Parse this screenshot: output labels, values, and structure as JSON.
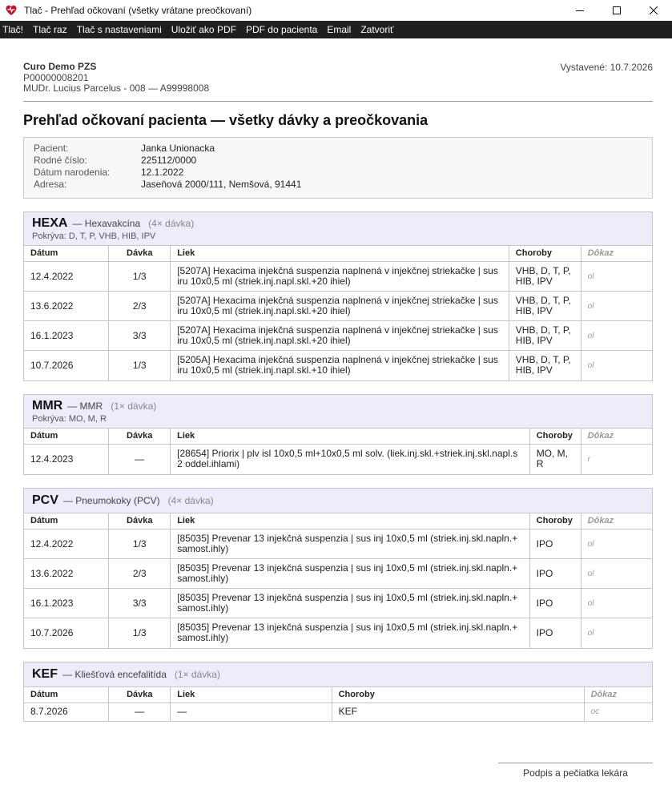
{
  "window": {
    "title": "Tlač - Prehľad očkovaní (všetky vrátane preočkovaní)"
  },
  "menu": [
    "Tlač!",
    "Tlač raz",
    "Tlač s nastaveniami",
    "Uložiť ako PDF",
    "PDF do pacienta",
    "Email",
    "Zatvoriť"
  ],
  "header": {
    "clinic_name": "Curo Demo PZS",
    "clinic_code": "P00000008201",
    "doctor": "MUDr. Lucius Parcelus - 008 — A99998008",
    "issued": "Vystavené: 10.7.2026"
  },
  "title": "Prehľad očkovaní pacienta — všetky dávky a preočkovania",
  "patient": [
    {
      "label": "Pacient:",
      "value": "Janka Unionacka"
    },
    {
      "label": "Rodné číslo:",
      "value": "225112/0000"
    },
    {
      "label": "Dátum narodenia:",
      "value": "12.1.2022"
    },
    {
      "label": "Adresa:",
      "value": "Jaseňová 2000/111, Nemšová, 91441"
    }
  ],
  "columns": {
    "date": "Dátum",
    "dose": "Dávka",
    "drug": "Liek",
    "diseases": "Choroby",
    "proof": "Dôkaz"
  },
  "groups": [
    {
      "code": "HEXA",
      "name": "— Hexavakcína",
      "count": "(4× dávka)",
      "covers": "Pokrýva: D, T, P, VHB, HIB, IPV",
      "rows": [
        {
          "date": "12.4.2022",
          "dose": "1/3",
          "drug": "[5207A] Hexacima injekčná suspenzia naplnená v injekčnej striekačke | sus iru 10x0,5 ml (striek.inj.napl.skl.+20 ihiel)",
          "diseases": "VHB, D, T, P, HIB, IPV",
          "proof": "ol"
        },
        {
          "date": "13.6.2022",
          "dose": "2/3",
          "drug": "[5207A] Hexacima injekčná suspenzia naplnená v injekčnej striekačke | sus iru 10x0,5 ml (striek.inj.napl.skl.+20 ihiel)",
          "diseases": "VHB, D, T, P, HIB, IPV",
          "proof": "ol"
        },
        {
          "date": "16.1.2023",
          "dose": "3/3",
          "drug": "[5207A] Hexacima injekčná suspenzia naplnená v injekčnej striekačke | sus iru 10x0,5 ml (striek.inj.napl.skl.+20 ihiel)",
          "diseases": "VHB, D, T, P, HIB, IPV",
          "proof": "ol"
        },
        {
          "date": "10.7.2026",
          "dose": "1/3",
          "drug": "[5205A] Hexacima injekčná suspenzia naplnená v injekčnej striekačke | sus iru 10x0,5 ml (striek.inj.napl.skl.+10 ihiel)",
          "diseases": "VHB, D, T, P, HIB, IPV",
          "proof": "ol"
        }
      ]
    },
    {
      "code": "MMR",
      "name": "— MMR",
      "count": "(1× dávka)",
      "covers": "Pokrýva: MO, M, R",
      "rows": [
        {
          "date": "12.4.2023",
          "dose": "—",
          "drug": "[28654] Priorix | plv isl 10x0,5 ml+10x0,5 ml solv. (liek.inj.skl.+striek.inj.skl.napl.s 2 oddel.ihlami)",
          "diseases": "MO, M, R",
          "proof": "r"
        }
      ]
    },
    {
      "code": "PCV",
      "name": "— Pneumokoky (PCV)",
      "count": "(4× dávka)",
      "covers": "",
      "rows": [
        {
          "date": "12.4.2022",
          "dose": "1/3",
          "drug": "[85035] Prevenar 13 injekčná suspenzia | sus inj 10x0,5 ml (striek.inj.skl.napln.+ samost.ihly)",
          "diseases": "IPO",
          "proof": "ol"
        },
        {
          "date": "13.6.2022",
          "dose": "2/3",
          "drug": "[85035] Prevenar 13 injekčná suspenzia | sus inj 10x0,5 ml (striek.inj.skl.napln.+ samost.ihly)",
          "diseases": "IPO",
          "proof": "ol"
        },
        {
          "date": "16.1.2023",
          "dose": "3/3",
          "drug": "[85035] Prevenar 13 injekčná suspenzia | sus inj 10x0,5 ml (striek.inj.skl.napln.+ samost.ihly)",
          "diseases": "IPO",
          "proof": "ol"
        },
        {
          "date": "10.7.2026",
          "dose": "1/3",
          "drug": "[85035] Prevenar 13 injekčná suspenzia | sus inj 10x0,5 ml (striek.inj.skl.napln.+ samost.ihly)",
          "diseases": "IPO",
          "proof": "ol"
        }
      ]
    },
    {
      "code": "KEF",
      "name": "— Kliešťová encefalitída",
      "count": "(1× dávka)",
      "covers": "",
      "rows": [
        {
          "date": "8.7.2026",
          "dose": "—",
          "drug": "—",
          "diseases": "KEF",
          "proof": "oc"
        }
      ]
    }
  ],
  "signature": "Podpis a pečiatka lekára"
}
